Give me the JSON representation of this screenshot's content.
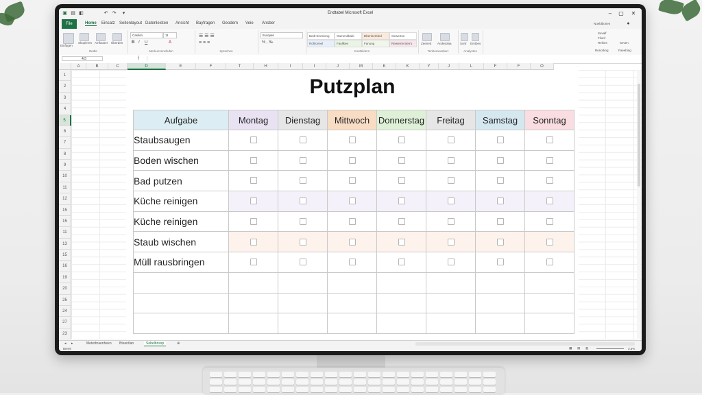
{
  "window": {
    "title": "Endtabel Microsoft Excel"
  },
  "tabs": [
    "File",
    "Home",
    "Einsatz",
    "Seitenlayout",
    "Datenleisten",
    "Ansicht",
    "Bayfragen",
    "Geodem",
    "Veie",
    "Ansber"
  ],
  "ribbon": {
    "paste": "Einfügen",
    "clipboard_items": [
      "Skopieren",
      "Amfauser",
      "Übnrden"
    ],
    "font_name": "Caslion",
    "font_size": "11",
    "number_format": "Europen",
    "styles": [
      "Bedt Einrelong",
      "Gamenkbabi",
      "Dbenherbled",
      "Gewerten",
      "Rohlovnel",
      "Faullkee",
      "Fanung",
      "Rewerne Berro"
    ],
    "groups": [
      "Bedte",
      "Merkunzenellubin",
      "Sprachen",
      "Kostbildern",
      "Tenbenwusbarr",
      "Analystes"
    ],
    "cells_items": [
      "Zeenett",
      "Anderplaa"
    ],
    "edit_items": [
      "Sortr",
      "Emtbes"
    ],
    "right_items": [
      "Sevalf",
      "Filoof",
      "Reikes",
      "Seven"
    ],
    "right_labels": [
      "Renorkng",
      "Faeebing"
    ],
    "account": "Nueldbonen"
  },
  "formula_bar": {
    "name_box": "4/3",
    "fx": "ƒ"
  },
  "columns": [
    "A",
    "B",
    "C",
    "D",
    "E",
    "F",
    "T",
    "H",
    "I",
    "I",
    "J",
    "M",
    "K",
    "K",
    "Y",
    "J",
    "L",
    "F",
    "F",
    "O"
  ],
  "selected_column": "D",
  "rows": [
    "1",
    "2",
    "3",
    "4",
    "5",
    "6",
    "7",
    "8",
    "9",
    "10",
    "11",
    "12",
    "15",
    "15",
    "11",
    "13",
    "15",
    "16",
    "19",
    "20",
    "25",
    "24",
    "27",
    "23"
  ],
  "selected_row": "5",
  "sheet": {
    "title": "Putzplan",
    "task_header": "Aufgabe",
    "days": [
      {
        "label": "Montag",
        "color": "#e8e2f3"
      },
      {
        "label": "Dienstag",
        "color": "#e6e6e6"
      },
      {
        "label": "Mittwoch",
        "color": "#f9dcc4"
      },
      {
        "label": "Donnerstag",
        "color": "#dff0d8"
      },
      {
        "label": "Freitag",
        "color": "#e6e6e6"
      },
      {
        "label": "Samstag",
        "color": "#d5e8f0"
      },
      {
        "label": "Sonntag",
        "color": "#f9dde2"
      }
    ],
    "header_task_color": "#dceef3",
    "tasks": [
      "Staubsaugen",
      "Boden wischen",
      "Bad putzen",
      "Küche reinigen",
      "Küche reinigen",
      "Staub wischen",
      "Müll rausbringen"
    ]
  },
  "sheet_tabs": [
    "Meterbraenheen",
    "Bteentlan",
    "Sebelbrissp"
  ],
  "active_sheet_tab": "Sebelbrissp",
  "status": {
    "left": "Bereit",
    "zoom": "3,5%"
  }
}
